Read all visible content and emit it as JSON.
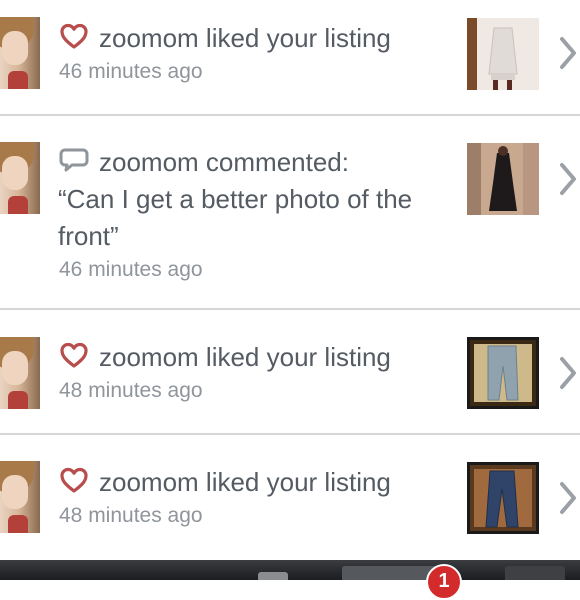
{
  "notifications": [
    {
      "type": "like",
      "icon": "heart-icon",
      "user": "zoomom",
      "text": "zoomom liked your listing",
      "time": "46 minutes ago"
    },
    {
      "type": "comment",
      "icon": "comment-bubble-icon",
      "user": "zoomom",
      "text": "zoomom commented:",
      "comment_line1": "“Can I get a better photo of the",
      "comment_line2": "front”",
      "time": "46 minutes ago"
    },
    {
      "type": "like",
      "icon": "heart-icon",
      "user": "zoomom",
      "text": "zoomom liked your listing",
      "time": "48 minutes ago"
    },
    {
      "type": "like",
      "icon": "heart-icon",
      "user": "zoomom",
      "text": "zoomom liked your listing",
      "time": "48 minutes ago"
    }
  ],
  "tab_bar": {
    "badge_count": "1"
  },
  "colors": {
    "accent": "#b84d4d",
    "text": "#555b63",
    "muted": "#8f959b",
    "divider": "#d6d6d6"
  }
}
